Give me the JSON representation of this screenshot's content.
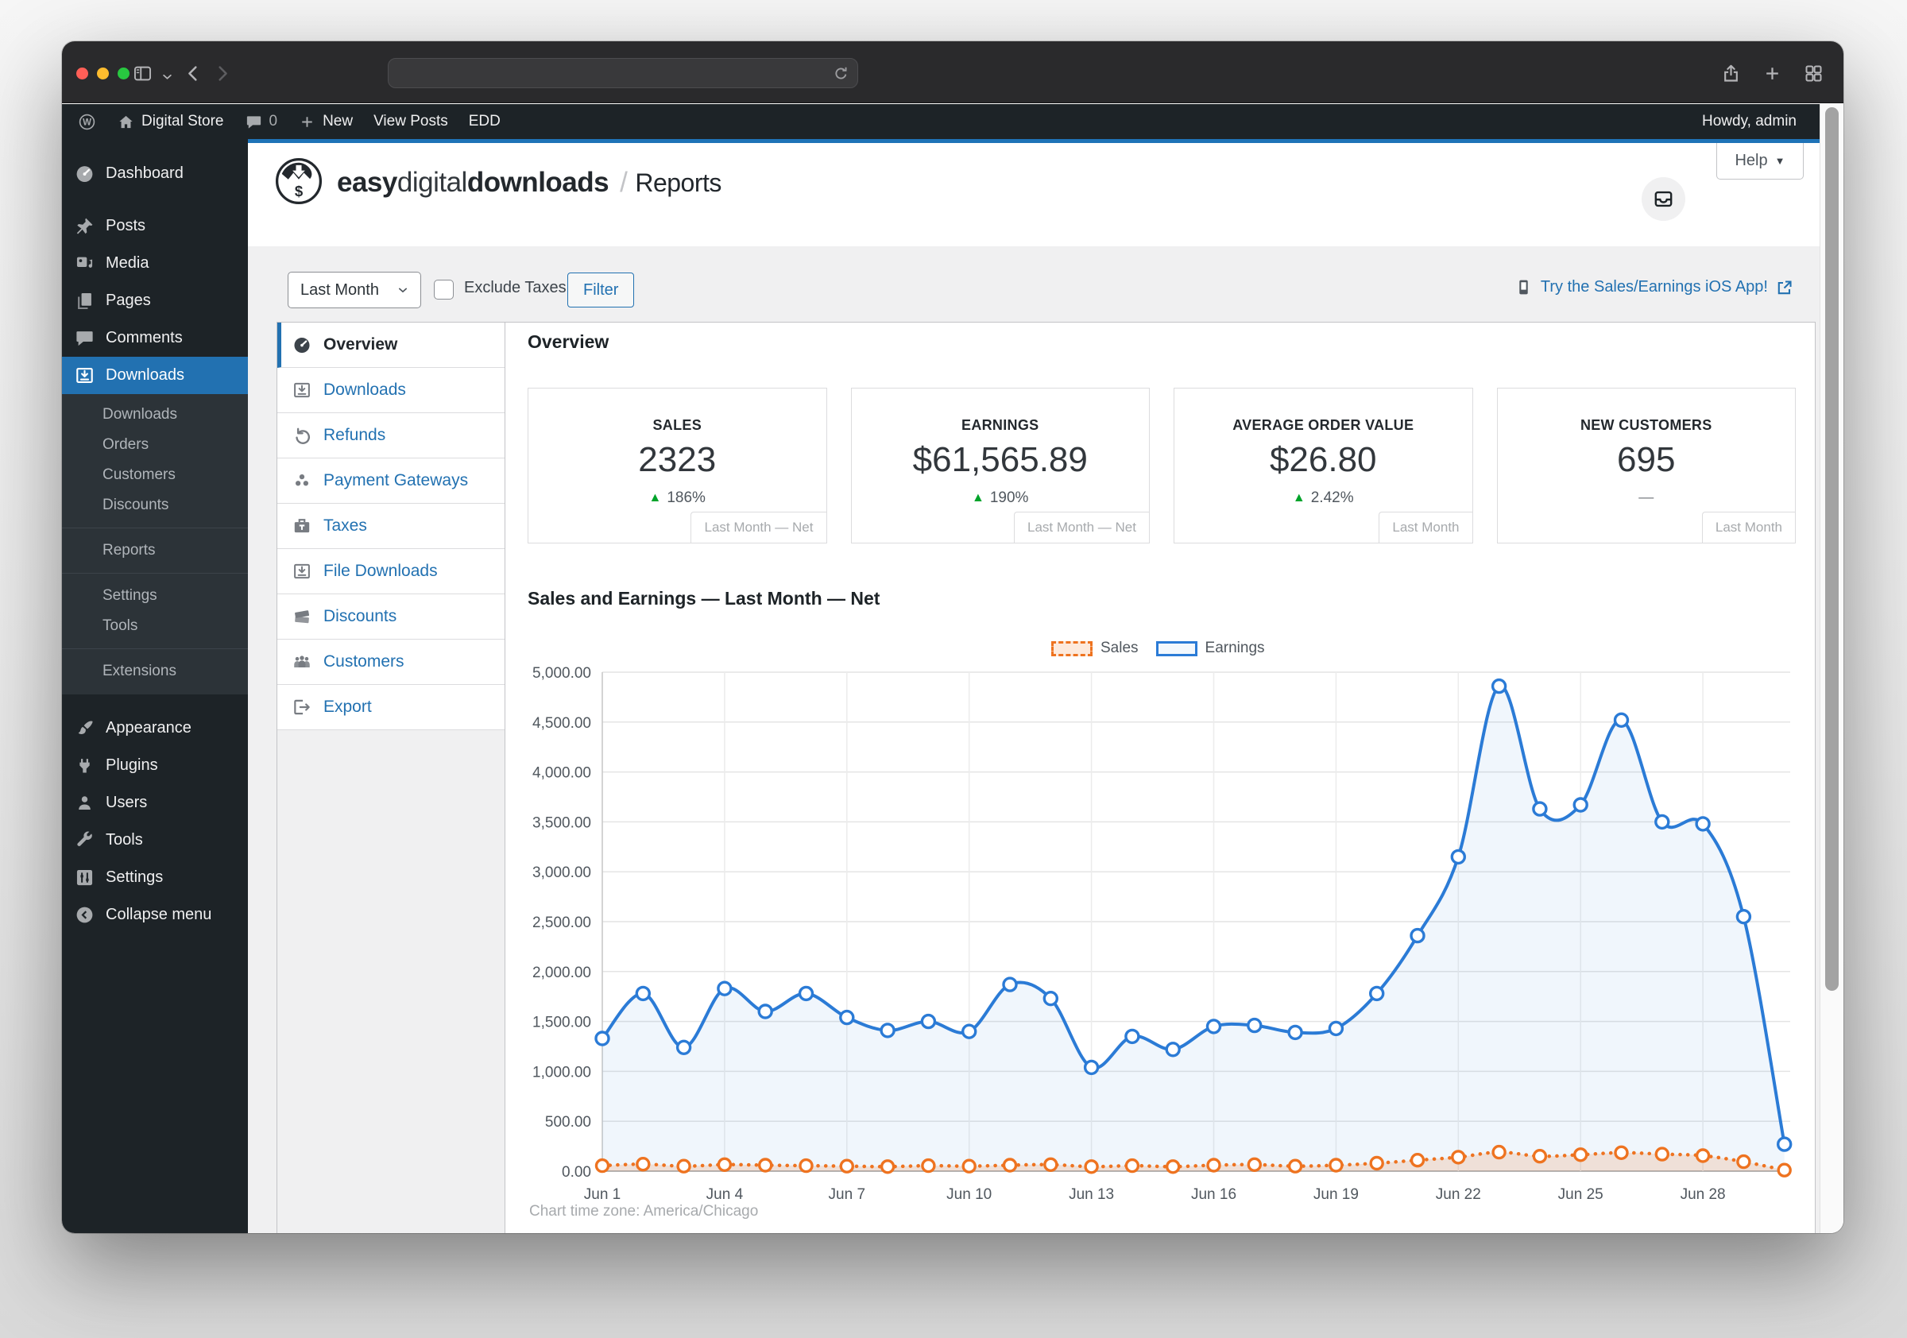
{
  "browser": {
    "url": "",
    "traffic_lights": [
      "#ff5f57",
      "#febc2e",
      "#28c840"
    ],
    "icons": [
      "sidebar-toggle-icon",
      "chevron-down-icon",
      "back-icon",
      "forward-icon",
      "reload-icon",
      "share-icon",
      "new-tab-icon",
      "tab-overview-icon"
    ]
  },
  "admin_bar": {
    "site_name": "Digital Store",
    "comments_count": "0",
    "new_label": "New",
    "view_posts_label": "View Posts",
    "edd_label": "EDD",
    "howdy": "Howdy, admin"
  },
  "sidebar": {
    "entries": [
      {
        "kind": "item",
        "icon": "gauge",
        "label": "Dashboard"
      },
      {
        "kind": "gap"
      },
      {
        "kind": "item",
        "icon": "pin",
        "label": "Posts"
      },
      {
        "kind": "item",
        "icon": "media",
        "label": "Media"
      },
      {
        "kind": "item",
        "icon": "pages",
        "label": "Pages"
      },
      {
        "kind": "item",
        "icon": "comment",
        "label": "Comments"
      },
      {
        "kind": "item",
        "icon": "download",
        "label": "Downloads",
        "active": true
      },
      {
        "kind": "sub",
        "label": "Downloads"
      },
      {
        "kind": "sub",
        "label": "Orders"
      },
      {
        "kind": "sub",
        "label": "Customers"
      },
      {
        "kind": "sub",
        "label": "Discounts"
      },
      {
        "kind": "sep"
      },
      {
        "kind": "sub",
        "label": "Reports"
      },
      {
        "kind": "sep"
      },
      {
        "kind": "sub",
        "label": "Settings"
      },
      {
        "kind": "sub",
        "label": "Tools"
      },
      {
        "kind": "sep"
      },
      {
        "kind": "sub",
        "label": "Extensions"
      },
      {
        "kind": "gap"
      },
      {
        "kind": "item",
        "icon": "brush",
        "label": "Appearance"
      },
      {
        "kind": "item",
        "icon": "plug",
        "label": "Plugins"
      },
      {
        "kind": "item",
        "icon": "user",
        "label": "Users"
      },
      {
        "kind": "item",
        "icon": "wrench",
        "label": "Tools"
      },
      {
        "kind": "item",
        "icon": "sliders",
        "label": "Settings"
      },
      {
        "kind": "item",
        "icon": "collapse",
        "label": "Collapse menu"
      }
    ]
  },
  "edd_header": {
    "brand_easy": "easy",
    "brand_digital": "digital",
    "brand_downloads": "downloads",
    "separator": "/",
    "page_title": "Reports",
    "help_label": "Help"
  },
  "filter_bar": {
    "range_value": "Last Month",
    "exclude_taxes_label": "Exclude Taxes",
    "filter_label": "Filter",
    "ios_link_label": "Try the Sales/Earnings iOS App!"
  },
  "report_tabs": [
    {
      "label": "Overview",
      "icon": "gauge",
      "active": true
    },
    {
      "label": "Downloads",
      "icon": "download"
    },
    {
      "label": "Refunds",
      "icon": "undo"
    },
    {
      "label": "Payment Gateways",
      "icon": "gateways"
    },
    {
      "label": "Taxes",
      "icon": "briefcase"
    },
    {
      "label": "File Downloads",
      "icon": "download"
    },
    {
      "label": "Discounts",
      "icon": "tickets"
    },
    {
      "label": "Customers",
      "icon": "group"
    },
    {
      "label": "Export",
      "icon": "export"
    }
  ],
  "overview": {
    "heading": "Overview",
    "tiles": [
      {
        "label": "SALES",
        "value": "2323",
        "delta": "186%",
        "delta_dir": "up",
        "tag": "Last Month — Net"
      },
      {
        "label": "EARNINGS",
        "value": "$61,565.89",
        "delta": "190%",
        "delta_dir": "up",
        "tag": "Last Month — Net"
      },
      {
        "label": "AVERAGE ORDER VALUE",
        "value": "$26.80",
        "delta": "2.42%",
        "delta_dir": "up",
        "tag": "Last Month"
      },
      {
        "label": "NEW CUSTOMERS",
        "value": "695",
        "delta": "—",
        "delta_dir": "none",
        "tag": "Last Month"
      }
    ]
  },
  "chart_data": {
    "type": "line",
    "title": "Sales and Earnings — Last Month — Net",
    "timezone_note": "Chart time zone: America/Chicago",
    "x": [
      "Jun 1",
      "Jun 2",
      "Jun 3",
      "Jun 4",
      "Jun 5",
      "Jun 6",
      "Jun 7",
      "Jun 8",
      "Jun 9",
      "Jun 10",
      "Jun 11",
      "Jun 12",
      "Jun 13",
      "Jun 14",
      "Jun 15",
      "Jun 16",
      "Jun 17",
      "Jun 18",
      "Jun 19",
      "Jun 20",
      "Jun 21",
      "Jun 22",
      "Jun 23",
      "Jun 24",
      "Jun 25",
      "Jun 26",
      "Jun 27",
      "Jun 28",
      "Jun 29",
      "Jun 30"
    ],
    "series": [
      {
        "name": "Sales",
        "color": "#ee7320",
        "fill": "rgba(238,115,32,0.16)",
        "style": "dotted",
        "values": [
          55,
          70,
          50,
          65,
          60,
          55,
          50,
          45,
          55,
          50,
          60,
          65,
          45,
          55,
          45,
          60,
          65,
          50,
          60,
          80,
          110,
          140,
          190,
          150,
          165,
          185,
          170,
          155,
          95,
          10
        ]
      },
      {
        "name": "Earnings",
        "color": "#2b7bd6",
        "fill": "rgba(43,123,214,0.07)",
        "style": "solid",
        "values": [
          1330,
          1780,
          1240,
          1830,
          1600,
          1780,
          1540,
          1410,
          1500,
          1400,
          1870,
          1730,
          1040,
          1350,
          1220,
          1450,
          1460,
          1390,
          1430,
          1780,
          2360,
          3150,
          4860,
          3630,
          3670,
          4520,
          3500,
          3480,
          2550,
          270
        ]
      }
    ],
    "ylim": [
      0,
      5000
    ],
    "ytick_step": 500,
    "ytick_labels": [
      "0.00",
      "500.00",
      "1,000.00",
      "1,500.00",
      "2,000.00",
      "2,500.00",
      "3,000.00",
      "3,500.00",
      "4,000.00",
      "4,500.00",
      "5,000.00"
    ],
    "xticks": [
      {
        "day": 0,
        "label": "Jun 1"
      },
      {
        "day": 3,
        "label": "Jun 4"
      },
      {
        "day": 6,
        "label": "Jun 7"
      },
      {
        "day": 9,
        "label": "Jun 10"
      },
      {
        "day": 12,
        "label": "Jun 13"
      },
      {
        "day": 15,
        "label": "Jun 16"
      },
      {
        "day": 18,
        "label": "Jun 19"
      },
      {
        "day": 21,
        "label": "Jun 22"
      },
      {
        "day": 24,
        "label": "Jun 25"
      },
      {
        "day": 27,
        "label": "Jun 28"
      }
    ],
    "legend_position": "top-right",
    "grid": true
  },
  "colors": {
    "accent": "#2271b1",
    "positive": "#00a32a",
    "sales": "#ee7320",
    "earnings": "#2b7bd6"
  }
}
